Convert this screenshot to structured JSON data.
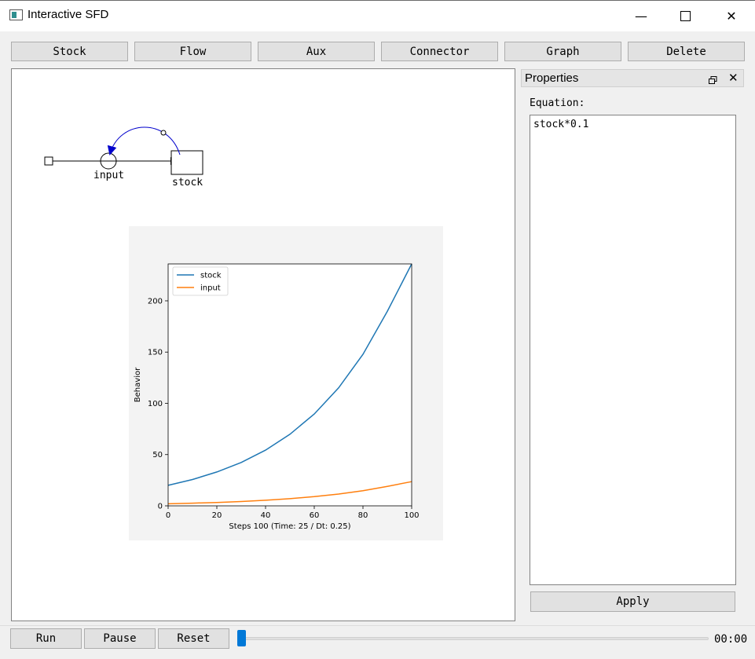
{
  "window": {
    "title": "Interactive SFD"
  },
  "toolbar": {
    "stock": "Stock",
    "flow": "Flow",
    "aux": "Aux",
    "connector": "Connector",
    "graph": "Graph",
    "delete": "Delete"
  },
  "diagram": {
    "flow_label": "input",
    "stock_label": "stock"
  },
  "properties": {
    "title": "Properties",
    "equation_label": "Equation:",
    "equation_value": "stock*0.1",
    "apply": "Apply"
  },
  "controls": {
    "run": "Run",
    "pause": "Pause",
    "reset": "Reset",
    "time": "00:00",
    "slider_fraction": 0.0
  },
  "chart_data": {
    "type": "line",
    "title": "",
    "xlabel": "Steps 100 (Time: 25 / Dt: 0.25)",
    "ylabel": "Behavior",
    "xlim": [
      0,
      100
    ],
    "ylim": [
      0,
      236
    ],
    "xticks": [
      0,
      20,
      40,
      60,
      80,
      100
    ],
    "yticks": [
      0,
      50,
      100,
      150,
      200
    ],
    "legend_position": "top-left",
    "grid": false,
    "x": [
      0,
      10,
      20,
      30,
      40,
      50,
      60,
      70,
      80,
      90,
      100
    ],
    "series": [
      {
        "name": "stock",
        "color": "#1f77b4",
        "values": [
          20.0,
          25.7,
          33.0,
          42.3,
          54.3,
          69.8,
          89.6,
          115.1,
          147.8,
          189.7,
          236.0
        ]
      },
      {
        "name": "input",
        "color": "#ff7f0e",
        "values": [
          2.0,
          2.57,
          3.3,
          4.23,
          5.43,
          6.98,
          8.96,
          11.5,
          14.8,
          19.0,
          23.6
        ]
      }
    ]
  }
}
